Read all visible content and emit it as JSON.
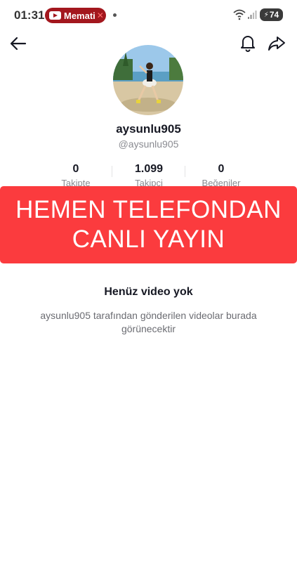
{
  "status_bar": {
    "time": "01:31",
    "notification_pill": {
      "icon": "youtube-icon",
      "text": "Memati",
      "color": "#a3171e"
    },
    "battery_level": "74",
    "icons": [
      "wifi-icon",
      "signal-icon",
      "battery-charging-icon"
    ]
  },
  "top_bar": {
    "back_icon": "arrow-left-icon",
    "bell_icon": "bell-icon",
    "share_icon": "share-icon"
  },
  "profile": {
    "username": "aysunlu905",
    "handle": "@aysunlu905"
  },
  "stats": [
    {
      "value": "0",
      "label": "Takipte"
    },
    {
      "value": "1.099",
      "label": "Takipçi"
    },
    {
      "value": "0",
      "label": "Beğeniler"
    }
  ],
  "banner": {
    "line1": "HEMEN TELEFONDAN",
    "line2": "CANLI YAYIN",
    "color": "#fb3b3e"
  },
  "empty_state": {
    "title": "Henüz video yok",
    "description": "aysunlu905 tarafından gönderilen videolar burada görünecektir"
  }
}
